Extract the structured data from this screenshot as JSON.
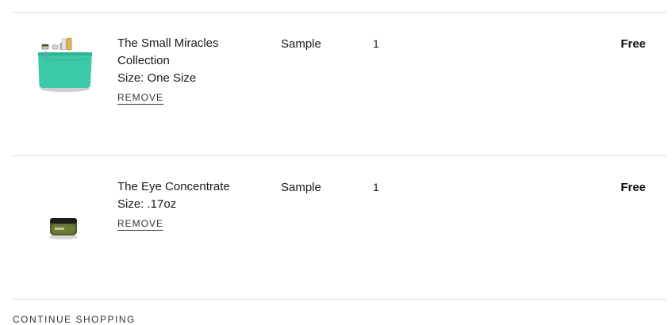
{
  "cart_items": [
    {
      "name_line1": "The Small Miracles",
      "name_line2": "Collection",
      "size": "Size: One Size",
      "remove_label": "REMOVE",
      "type": "Sample",
      "quantity": "1",
      "price": "Free",
      "image_icon": "pouch-gift-set-image"
    },
    {
      "name_line1": "The Eye Concentrate",
      "size": "Size: .17oz",
      "remove_label": "REMOVE",
      "type": "Sample",
      "quantity": "1",
      "price": "Free",
      "image_icon": "eye-cream-jar-image"
    }
  ],
  "footer": {
    "continue_label": "CONTINUE SHOPPING"
  },
  "colors": {
    "pouch": "#3cc9a7",
    "jar": "#4f5a2a",
    "divider": "#d9d9d9"
  }
}
